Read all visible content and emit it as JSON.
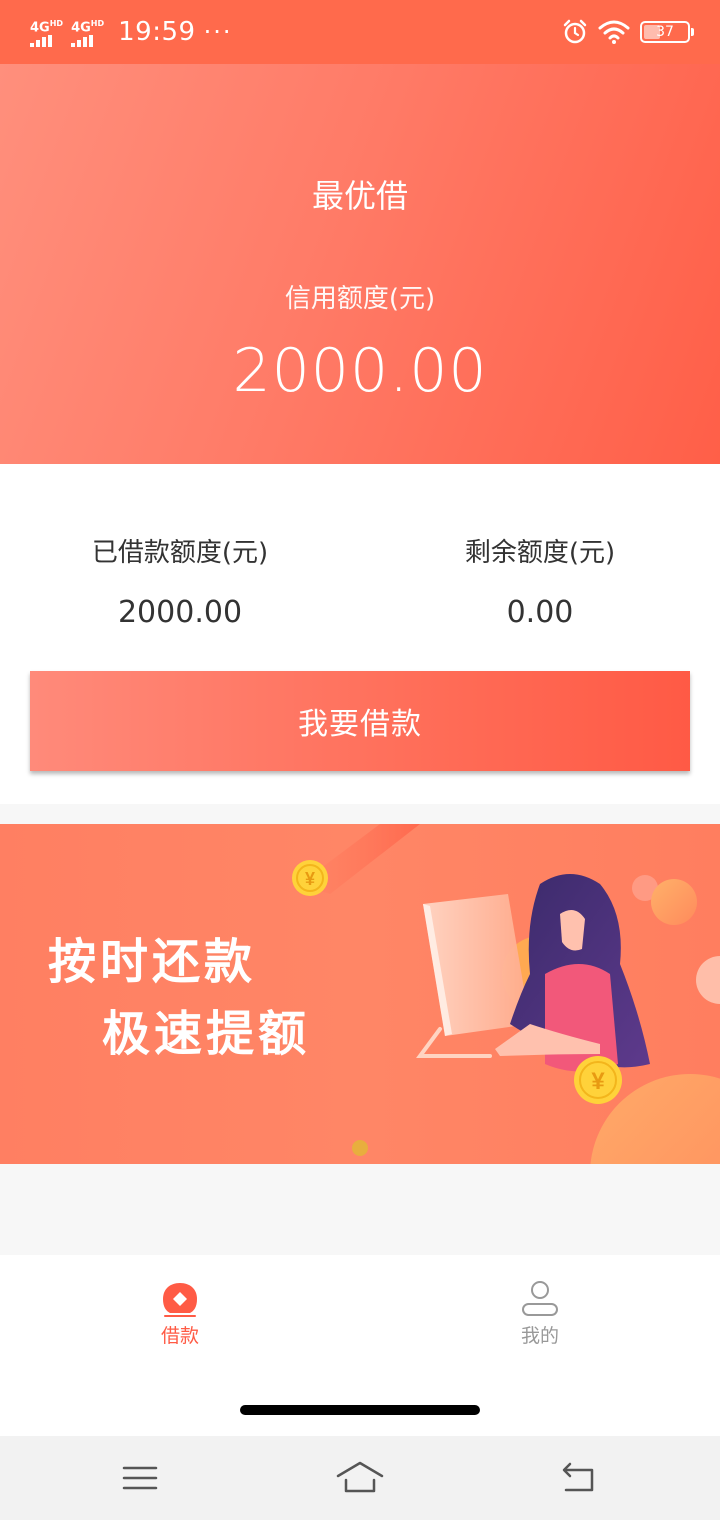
{
  "status_bar": {
    "signal1_label": "4G HD",
    "signal2_label": "4G HD",
    "time": "19:59",
    "dots": "···",
    "battery_level": "37",
    "icons": [
      "alarm-icon",
      "wifi-icon",
      "battery-icon"
    ]
  },
  "header": {
    "app_title": "最优借",
    "credit_label": "信用额度(元)",
    "credit_amount": "2000.00"
  },
  "stats": {
    "borrowed_label": "已借款额度(元)",
    "borrowed_value": "2000.00",
    "remaining_label": "剩余额度(元)",
    "remaining_value": "0.00"
  },
  "borrow_button": {
    "label": "我要借款"
  },
  "banner": {
    "line1": "按时还款",
    "line2": "极速提额",
    "coin_symbol": "¥"
  },
  "tabbar": {
    "tabs": [
      {
        "label": "借款",
        "icon": "loan-icon",
        "active": true
      },
      {
        "label": "我的",
        "icon": "profile-icon",
        "active": false
      }
    ]
  },
  "navbar": {
    "icons": [
      "menu-icon",
      "home-icon",
      "back-icon"
    ]
  },
  "colors": {
    "brand": "#ff6a4c",
    "accent": "#ff5b45",
    "inactive": "#999999"
  }
}
